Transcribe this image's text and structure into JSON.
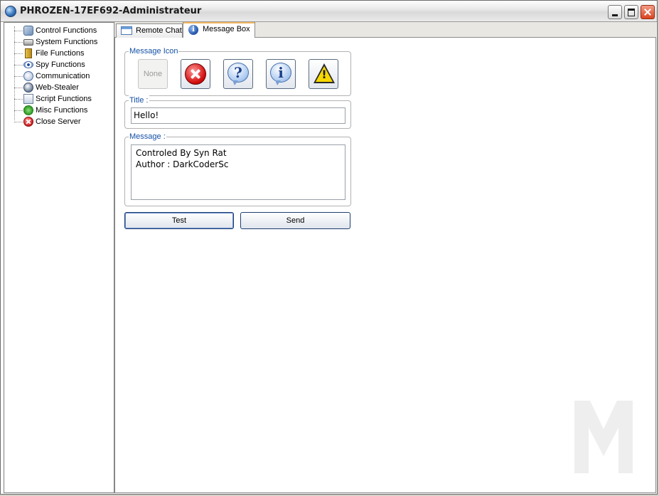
{
  "window": {
    "title": "PHROZEN-17EF692-Administrateur"
  },
  "sidebar": {
    "items": [
      {
        "label": "Control Functions",
        "icon": "control-panel-icon"
      },
      {
        "label": "System Functions",
        "icon": "keyboard-icon"
      },
      {
        "label": "File Functions",
        "icon": "folder-icon"
      },
      {
        "label": "Spy Functions",
        "icon": "eye-icon"
      },
      {
        "label": "Communication",
        "icon": "chat-icon"
      },
      {
        "label": "Web-Stealer",
        "icon": "globe-icon"
      },
      {
        "label": "Script Functions",
        "icon": "script-icon"
      },
      {
        "label": "Misc Functions",
        "icon": "gear-icon"
      },
      {
        "label": "Close Server",
        "icon": "close-icon"
      }
    ]
  },
  "tabs": [
    {
      "label": "Remote Chat",
      "active": false
    },
    {
      "label": "Message Box",
      "active": true
    }
  ],
  "message_icon": {
    "legend": "Message Icon",
    "none_label": "None",
    "options": [
      "none",
      "error",
      "question",
      "information",
      "warning"
    ],
    "question_glyph": "?",
    "info_glyph": "i",
    "warning_glyph": "!"
  },
  "title_group": {
    "legend": "Title :",
    "value": "Hello!"
  },
  "message_group": {
    "legend": "Message :",
    "lines": [
      "Controled By Syn Rat",
      "Author : DarkCoderSc"
    ]
  },
  "actions": {
    "test_label": "Test",
    "send_label": "Send"
  }
}
